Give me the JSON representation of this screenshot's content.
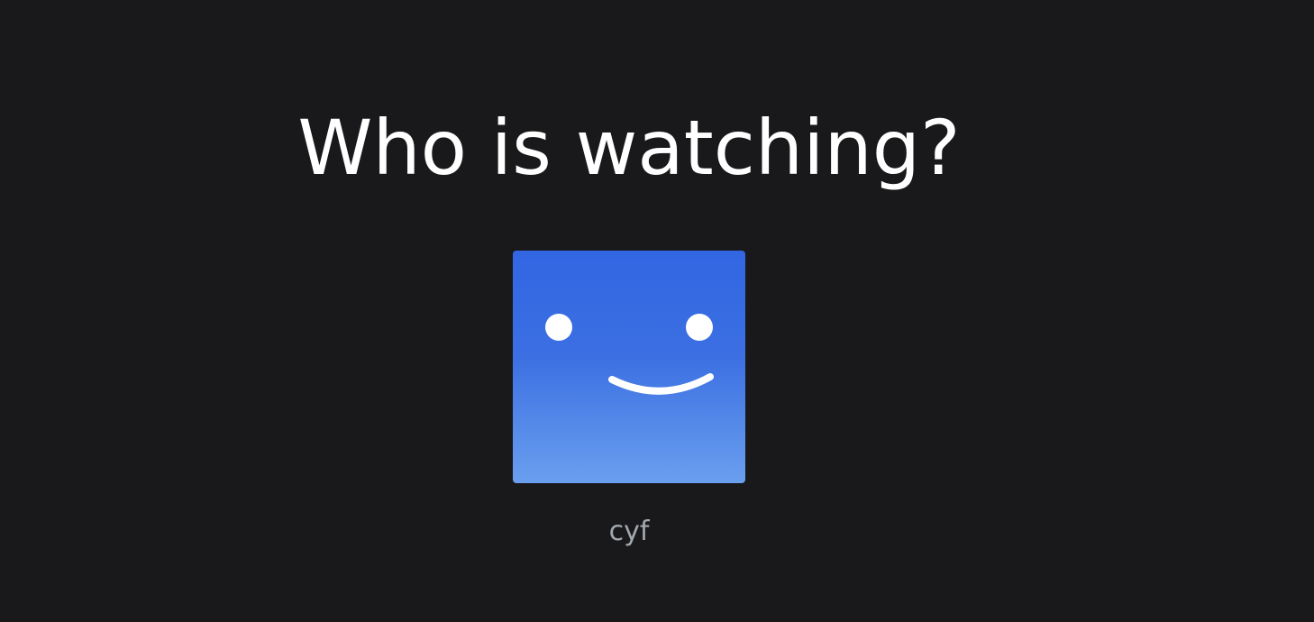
{
  "heading": "Who is watching?",
  "profiles": [
    {
      "name": "cyf",
      "avatar_icon": "smiley-face-icon",
      "avatar_color_top": "#3266e3",
      "avatar_color_bottom": "#6a9fef"
    }
  ],
  "colors": {
    "background": "#19191b",
    "heading": "#ffffff",
    "profile_name": "#a3a8ae"
  }
}
